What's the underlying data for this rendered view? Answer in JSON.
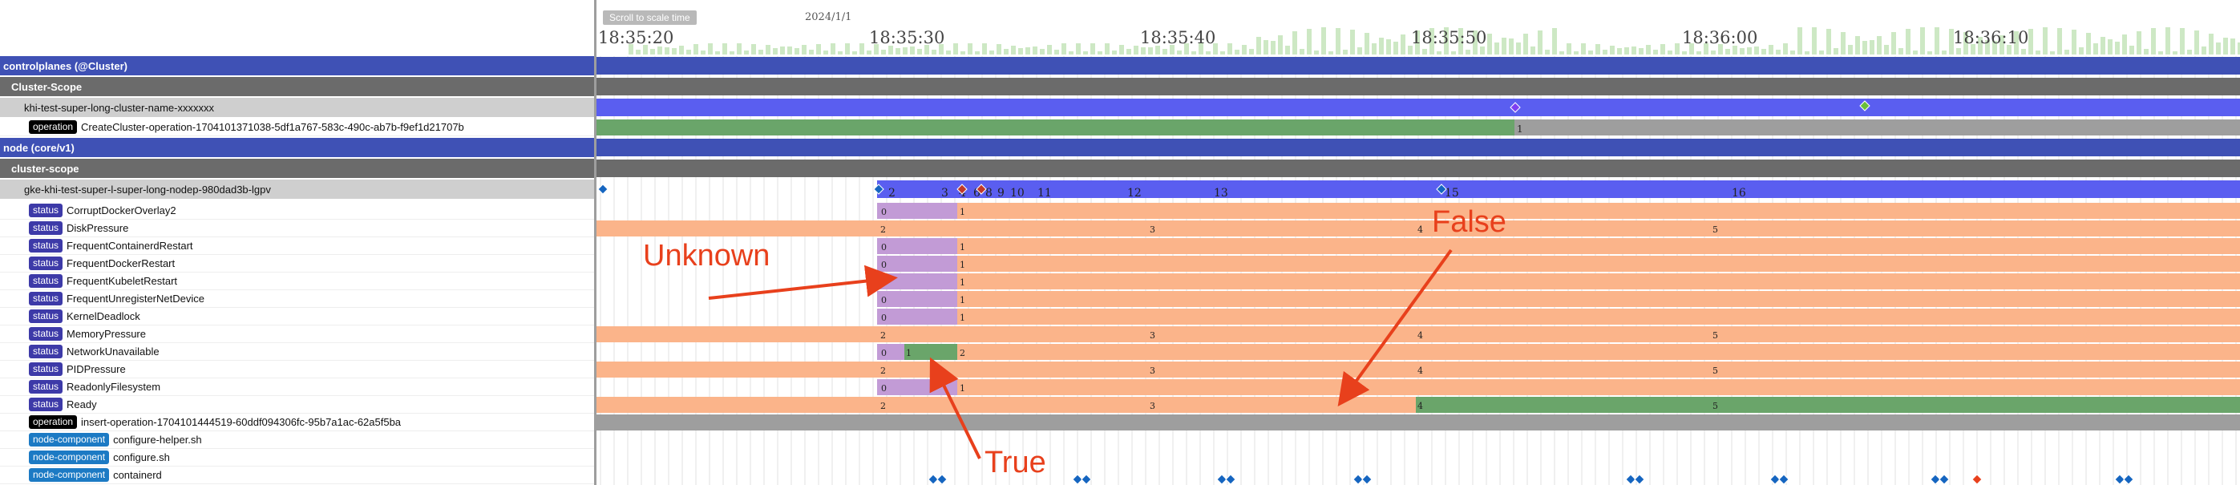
{
  "scale_button": "Scroll to scale time",
  "date_label": "2024/1/1",
  "time_ticks": [
    "18:35:20",
    "18:35:30",
    "18:35:40",
    "18:35:50",
    "18:36:00",
    "18:36:10"
  ],
  "rows": [
    {
      "type": "category",
      "label": "controlplanes (@Cluster)"
    },
    {
      "type": "kind",
      "label": "Cluster-Scope"
    },
    {
      "type": "resource",
      "label": "khi-test-super-long-cluster-name-xxxxxxx"
    },
    {
      "type": "subresource",
      "tag": "operation",
      "label": "CreateCluster-operation-1704101371038-5df1a767-583c-490c-ab7b-f9ef1d21707b"
    },
    {
      "type": "category",
      "label": "node (core/v1)"
    },
    {
      "type": "kind",
      "label": "cluster-scope"
    },
    {
      "type": "resource",
      "label": "gke-khi-test-super-l-super-long-nodep-980dad3b-lgpv"
    },
    {
      "type": "subresource",
      "tag": "status",
      "label": "CorruptDockerOverlay2"
    },
    {
      "type": "subresource",
      "tag": "status",
      "label": "DiskPressure"
    },
    {
      "type": "subresource",
      "tag": "status",
      "label": "FrequentContainerdRestart"
    },
    {
      "type": "subresource",
      "tag": "status",
      "label": "FrequentDockerRestart"
    },
    {
      "type": "subresource",
      "tag": "status",
      "label": "FrequentKubeletRestart"
    },
    {
      "type": "subresource",
      "tag": "status",
      "label": "FrequentUnregisterNetDevice"
    },
    {
      "type": "subresource",
      "tag": "status",
      "label": "KernelDeadlock"
    },
    {
      "type": "subresource",
      "tag": "status",
      "label": "MemoryPressure"
    },
    {
      "type": "subresource",
      "tag": "status",
      "label": "NetworkUnavailable"
    },
    {
      "type": "subresource",
      "tag": "status",
      "label": "PIDPressure"
    },
    {
      "type": "subresource",
      "tag": "status",
      "label": "ReadonlyFilesystem"
    },
    {
      "type": "subresource",
      "tag": "status",
      "label": "Ready"
    },
    {
      "type": "subresource",
      "tag": "operation",
      "label": "insert-operation-1704101444519-60ddf094306fc-95b7a1ac-62a5f5ba"
    },
    {
      "type": "subresource",
      "tag": "node-component",
      "label": "configure-helper.sh"
    },
    {
      "type": "subresource",
      "tag": "node-component",
      "label": "configure.sh"
    },
    {
      "type": "subresource",
      "tag": "node-component",
      "label": "containerd"
    }
  ],
  "revision_labels": {
    "cluster_op": [
      "1"
    ],
    "node_main": [
      "2",
      "3",
      "4",
      "6",
      "8",
      "9",
      "10",
      "11",
      "12",
      "13",
      "15",
      "16"
    ],
    "unknown_true": [
      "0",
      "1"
    ],
    "pressure": [
      "2",
      "3",
      "4",
      "5"
    ],
    "network": [
      "0",
      "1",
      "2"
    ],
    "ready": [
      "2",
      "3",
      "4",
      "5"
    ]
  },
  "callouts": {
    "unknown": "Unknown",
    "false": "False",
    "true": "True"
  },
  "colors": {
    "category": "#3f51b5",
    "kind": "#6b6b6b",
    "resource": "#cfcfcf",
    "lane_blue": "#5a5ef0",
    "lane_gray": "#9e9e9e",
    "lane_green": "#6aa56a",
    "state_false": "#fbb48a",
    "state_unknown": "#c29bd6",
    "state_true": "#6aa56a",
    "callout": "#e8401c",
    "diamond": "#1565c0"
  }
}
